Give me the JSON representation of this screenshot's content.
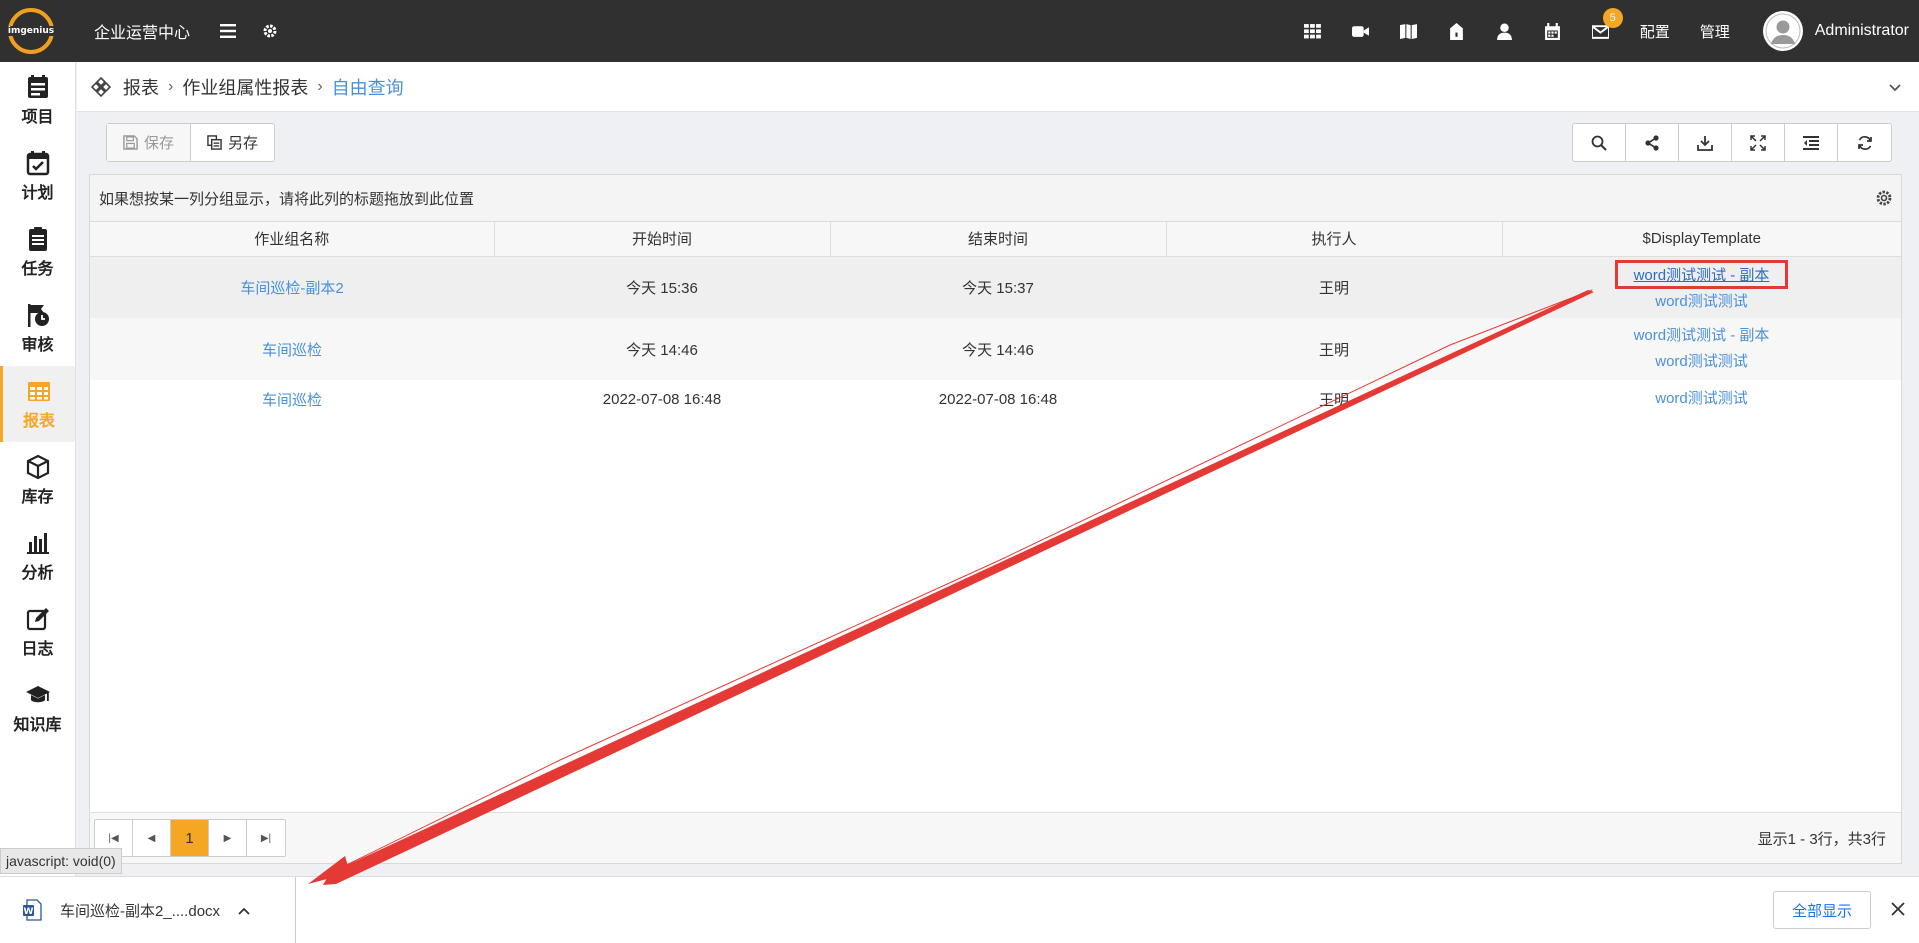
{
  "header": {
    "logo_text": "imgenius",
    "title": "企业运营中心",
    "badge_count": "5",
    "config_label": "配置",
    "manage_label": "管理",
    "user_name": "Administrator"
  },
  "sidebar": {
    "items": [
      {
        "label": "项目",
        "icon": "project-icon"
      },
      {
        "label": "计划",
        "icon": "calendar-check-icon"
      },
      {
        "label": "任务",
        "icon": "clipboard-icon"
      },
      {
        "label": "审核",
        "icon": "flag-clock-icon"
      },
      {
        "label": "报表",
        "icon": "table-icon",
        "active": true
      },
      {
        "label": "库存",
        "icon": "box-icon"
      },
      {
        "label": "分析",
        "icon": "bar-chart-icon"
      },
      {
        "label": "日志",
        "icon": "edit-icon"
      },
      {
        "label": "知识库",
        "icon": "graduation-cap-icon"
      }
    ]
  },
  "breadcrumb": {
    "items": [
      "报表",
      "作业组属性报表"
    ],
    "current": "自由查询"
  },
  "toolbar": {
    "save_label": "保存",
    "save_as_label": "另存"
  },
  "grid": {
    "group_hint": "如果想按某一列分组显示，请将此列的标题拖放到此位置",
    "columns": [
      "作业组名称",
      "开始时间",
      "结束时间",
      "执行人",
      "$DisplayTemplate"
    ],
    "rows": [
      {
        "name": "车间巡检-副本2",
        "start": "今天 15:36",
        "end": "今天 15:37",
        "executor": "王明",
        "templates": [
          "word测试测试 - 副本",
          "word测试测试"
        ]
      },
      {
        "name": "车间巡检",
        "start": "今天 14:46",
        "end": "今天 14:46",
        "executor": "王明",
        "templates": [
          "word测试测试 - 副本",
          "word测试测试"
        ]
      },
      {
        "name": "车间巡检",
        "start": "2022-07-08 16:48",
        "end": "2022-07-08 16:48",
        "executor": "王明",
        "templates": [
          "word测试测试"
        ]
      }
    ]
  },
  "pager": {
    "current_page": "1",
    "info": "显示1 - 3行，共3行"
  },
  "status_url": "javascript: void(0)",
  "download": {
    "file_name": "车间巡检-副本2_....docx",
    "show_all_label": "全部显示"
  },
  "colors": {
    "accent": "#f5a623",
    "link": "#4a90d9",
    "highlight": "#e53935"
  }
}
